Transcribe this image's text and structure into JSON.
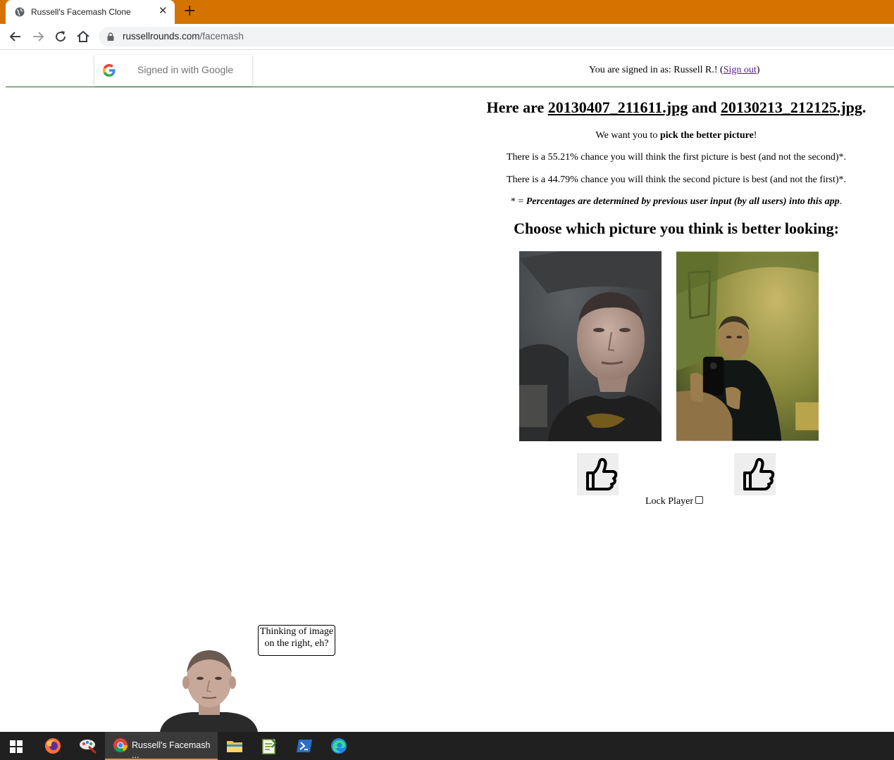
{
  "browser": {
    "tab_title": "Russell's Facemash Clone",
    "tab_close": "✕",
    "new_tab": "+",
    "url_host": "russellrounds.com",
    "url_path": "/facemash"
  },
  "header": {
    "google_signin_text": "Signed in with Google",
    "signed_as_prefix": "You are signed in as: Russell R.! (",
    "sign_out": "Sign out",
    "signed_as_suffix": ")"
  },
  "main": {
    "heading_prefix": "Here are ",
    "first_image_name": "20130407_211611.jpg",
    "heading_and": " and ",
    "second_image_name": "20130213_212125.jpg",
    "heading_suffix": ".",
    "pick_prefix": "We want you to ",
    "pick_bold": "pick the better picture",
    "pick_suffix": "!",
    "first_chance": "There is a 55.21% chance you will think the first picture is best (and not the second)*.",
    "second_chance": "There is a 44.79% chance you will think the second picture is best (and not the first)*.",
    "footnote_star": "* = ",
    "footnote_italic": "Percentages are determined by previous user input (by all users) into this app",
    "footnote_end": ".",
    "choose_title": "Choose which picture you think is better looking:",
    "lock_player": "Lock Player",
    "lock_player_checked": false
  },
  "assistant": {
    "bubble_line1": "Thinking of image",
    "bubble_line2": "on the right, eh?"
  },
  "taskbar": {
    "active_label": "Russell's Facemash ...",
    "icons": [
      "windows-start-icon",
      "firefox-icon",
      "paint-icon",
      "chrome-icon",
      "file-explorer-icon",
      "notepad-icon",
      "powershell-icon",
      "edge-icon"
    ]
  },
  "colors": {
    "tabstrip": "#d47300",
    "divider": "#1e6b1e",
    "taskbar": "#202020"
  }
}
